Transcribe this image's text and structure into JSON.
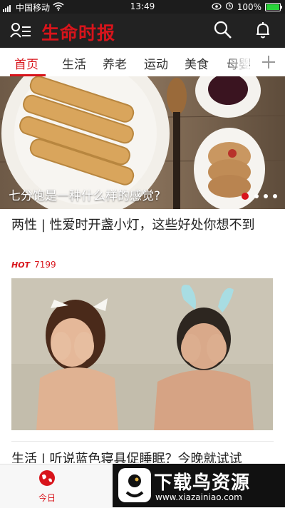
{
  "status_bar": {
    "carrier": "中国移动",
    "time": "13:49",
    "battery": "100%",
    "battery_level": 1.0
  },
  "header": {
    "logo": "生命时报",
    "icons": [
      "menu-icon",
      "search-icon",
      "bell-icon"
    ]
  },
  "tabs": {
    "items": [
      "首页",
      "生活",
      "养老",
      "运动",
      "美食",
      "母婴"
    ],
    "active_index": 0,
    "add_icon": "plus-icon"
  },
  "banner": {
    "caption": "七分饱是一种什么样的感觉?",
    "slide_count": 4,
    "active_slide": 0
  },
  "feed": {
    "article1_title": "两性 | 性爱时开盏小灯，这些好处你想不到",
    "hot_badge": "HOT",
    "hot_count": "7199",
    "article2_title": "生活 | 听说蓝色寝具促睡眠？今晚就试试"
  },
  "bottom_nav": {
    "today_label": "今日"
  },
  "watermark": {
    "brand": "下载鸟资源",
    "url": "www.xiazainiao.com"
  },
  "colors": {
    "accent": "#d8141b",
    "header_bg": "#222222"
  }
}
